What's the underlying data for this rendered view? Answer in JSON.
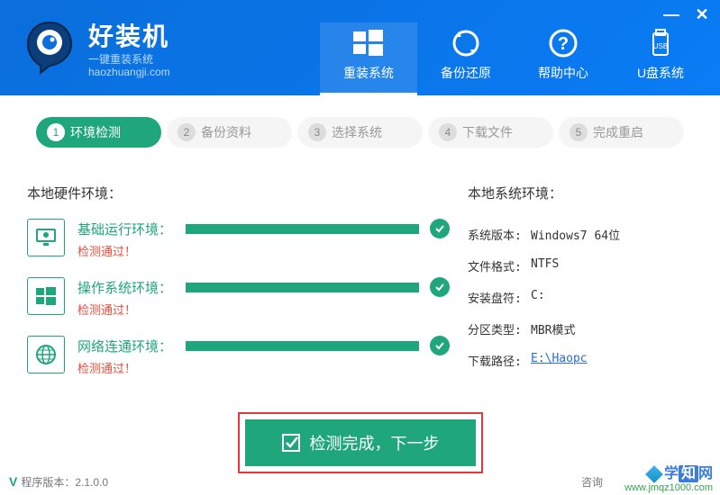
{
  "header": {
    "title": "好装机",
    "subtitle_line1": "一键重装系统",
    "subtitle_line2": "haozhuangji.com"
  },
  "window": {
    "minimize": "—",
    "close": "✕"
  },
  "nav": [
    {
      "label": "重装系统",
      "active": true
    },
    {
      "label": "备份还原",
      "active": false
    },
    {
      "label": "帮助中心",
      "active": false
    },
    {
      "label": "U盘系统",
      "active": false
    }
  ],
  "steps": [
    {
      "num": "1",
      "label": "环境检测",
      "active": true
    },
    {
      "num": "2",
      "label": "备份资料",
      "active": false
    },
    {
      "num": "3",
      "label": "选择系统",
      "active": false
    },
    {
      "num": "4",
      "label": "下载文件",
      "active": false
    },
    {
      "num": "5",
      "label": "完成重启",
      "active": false
    }
  ],
  "hw_section_title": "本地硬件环境：",
  "sys_section_title": "本地系统环境：",
  "checks": [
    {
      "label": "基础运行环境：",
      "result": "检测通过！",
      "icon": "monitor"
    },
    {
      "label": "操作系统环境：",
      "result": "检测通过！",
      "icon": "windows"
    },
    {
      "label": "网络连通环境：",
      "result": "检测通过！",
      "icon": "globe"
    }
  ],
  "sysinfo": {
    "version_label": "系统版本:",
    "version_value": "Windows7  64位",
    "fs_label": "文件格式:",
    "fs_value": "NTFS",
    "drive_label": "安装盘符:",
    "drive_value": "C:",
    "part_label": "分区类型:",
    "part_value": "MBR模式",
    "path_label": "下载路径:",
    "path_value": "E:\\Haopc"
  },
  "main_button": "检测完成，下一步",
  "footer": {
    "version_label": "程序版本：",
    "version_value": "2.1.0.0",
    "consult": "咨询"
  },
  "watermark": {
    "brand1": "学",
    "brand2": "知",
    "brand3": "网",
    "url": "www.jmqz1000.com"
  }
}
